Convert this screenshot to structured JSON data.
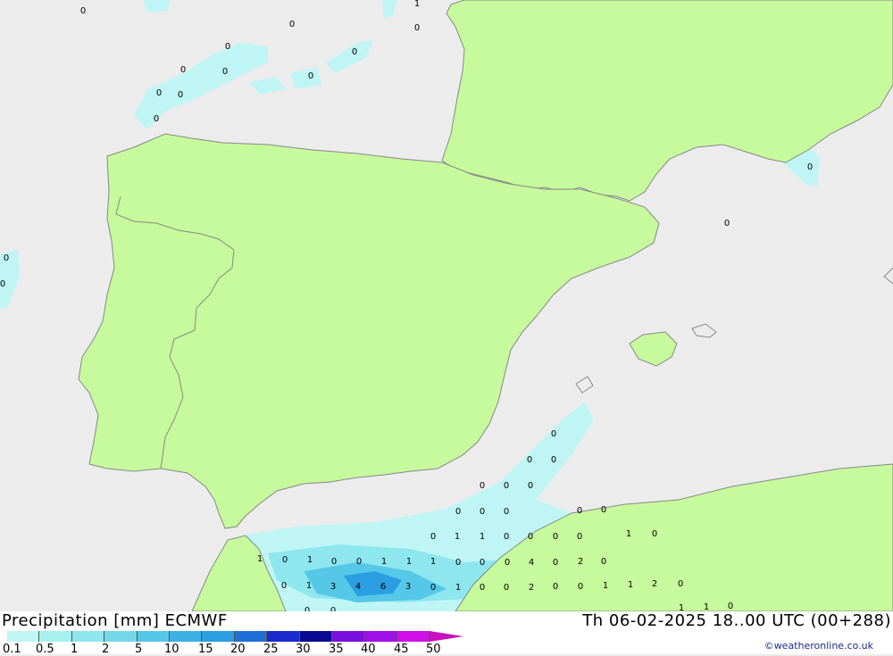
{
  "map": {
    "colors": {
      "sea": "#ececec",
      "land": "#c6fa9c",
      "border": "#888888",
      "precip_light": "#bff6f5",
      "precip_mid": "#8ee6ee",
      "precip_heavy": "#55c8e8",
      "precip_strong": "#2a9ee0"
    },
    "values": [
      "0",
      "0",
      "0",
      "0",
      "0",
      "0",
      "0",
      "0",
      "0",
      "0",
      "1",
      "0",
      "0",
      "0",
      "0",
      "0",
      "0",
      "0",
      "0",
      "0",
      "0",
      "0",
      "0",
      "0",
      "0",
      "0",
      "0",
      "0",
      "0",
      "0",
      "0",
      "1",
      "1",
      "0",
      "0",
      "0",
      "0",
      "1",
      "0",
      "1",
      "0",
      "1",
      "0",
      "0",
      "1",
      "1",
      "1",
      "0",
      "0",
      "4",
      "2",
      "0",
      "1",
      "3",
      "4",
      "6",
      "3",
      "0",
      "1",
      "0",
      "0",
      "2",
      "0",
      "0",
      "1",
      "1",
      "2",
      "0",
      "0",
      "0",
      "1",
      "1",
      "0"
    ]
  },
  "footer": {
    "title": "Precipitation [mm] ECMWF",
    "datetime": "Th 06-02-2025 18..00 UTC (00+288)",
    "credit": "©weatheronline.co.uk",
    "scale": {
      "labels": [
        "0.1",
        "0.5",
        "1",
        "2",
        "5",
        "10",
        "15",
        "20",
        "25",
        "30",
        "35",
        "40",
        "45",
        "50"
      ],
      "colors": [
        "#bff6f5",
        "#a6f0f0",
        "#8ee6ee",
        "#72d8ea",
        "#55c8e8",
        "#3fb0e4",
        "#2a9ee0",
        "#1f6fd6",
        "#1a2acc",
        "#0a0a90",
        "#7a10e0",
        "#a010e8",
        "#d010e8",
        "#c810c0"
      ]
    }
  }
}
